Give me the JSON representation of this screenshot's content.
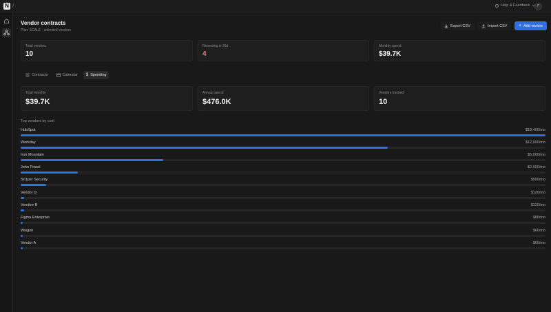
{
  "topbar": {
    "logo": "N",
    "separator": "/",
    "help": "Help & Feedback",
    "avatar_initial": "F"
  },
  "header": {
    "title": "Vendor contracts",
    "subtitle": "Plan: SCALE · unlimited vendors"
  },
  "actions": {
    "export": "Export CSV",
    "import": "Import CSV",
    "add": "Add vendor"
  },
  "stats": [
    {
      "label": "Total vendors",
      "value": "10"
    },
    {
      "label": "Renewing in 30d",
      "value": "4"
    },
    {
      "label": "Monthly spend",
      "value": "$39.7K"
    }
  ],
  "tabs": [
    {
      "label": "Contracts",
      "icon": "list-icon"
    },
    {
      "label": "Calendar",
      "icon": "calendar-icon"
    },
    {
      "label": "Spending",
      "icon": "dollar-icon"
    }
  ],
  "spending": {
    "cards": [
      {
        "label": "Total monthly",
        "value": "$39.7K"
      },
      {
        "label": "Annual spend",
        "value": "$476.0K"
      },
      {
        "label": "Vendors tracked",
        "value": "10"
      }
    ],
    "section_title": "Top vendors by cost",
    "vendors": [
      {
        "name": "HubSpot",
        "cost": "$18,400/mo",
        "share": 1.0
      },
      {
        "name": "Workday",
        "cost": "$12,900/mo",
        "share": 0.7
      },
      {
        "name": "Iron Mountain",
        "cost": "$5,000/mo",
        "share": 0.272
      },
      {
        "name": "John Powel",
        "cost": "$2,000/mo",
        "share": 0.109
      },
      {
        "name": "Sn1per Security",
        "cost": "$900/mo",
        "share": 0.049
      },
      {
        "name": "Vendor O",
        "cost": "$120/mo",
        "share": 0.0065
      },
      {
        "name": "Vendorr B",
        "cost": "$120/mo",
        "share": 0.0065
      },
      {
        "name": "Figma Enterprise",
        "cost": "$80/mo",
        "share": 0.0043
      },
      {
        "name": "Wisgon",
        "cost": "$60/mo",
        "share": 0.0033
      },
      {
        "name": "Vendor A",
        "cost": "$60/mo",
        "share": 0.0033
      }
    ]
  },
  "colors": {
    "accent": "#2f6fe0",
    "warning": "#f07a7a",
    "background": "#191919"
  }
}
